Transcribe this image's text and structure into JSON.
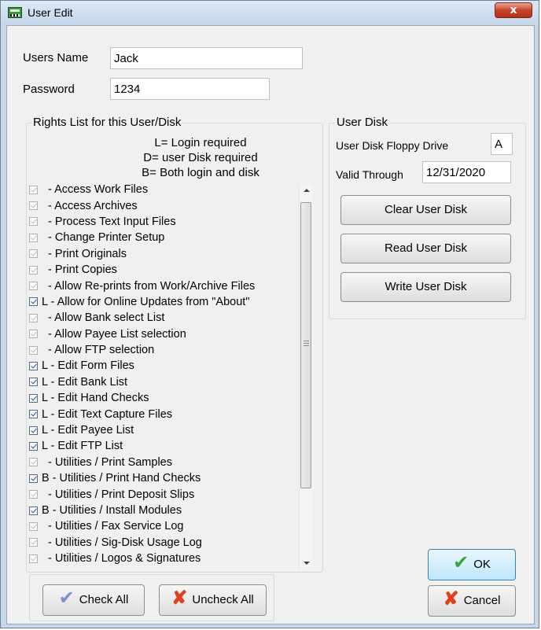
{
  "window": {
    "title": "User Edit",
    "close_label": "x"
  },
  "users_name": {
    "label": "Users Name",
    "value": "Jack"
  },
  "password": {
    "label": "Password",
    "value": "1234"
  },
  "rights": {
    "group_title": "Rights List for this User/Disk",
    "legend": [
      "L= Login required",
      "D= user Disk required",
      "B= Both login and disk"
    ],
    "items": [
      {
        "text": "  - Access Work Files",
        "checked": false
      },
      {
        "text": "  - Access Archives",
        "checked": false
      },
      {
        "text": "  - Process Text Input Files",
        "checked": false
      },
      {
        "text": "  - Change Printer Setup",
        "checked": false
      },
      {
        "text": "  - Print Originals",
        "checked": false
      },
      {
        "text": "  - Print Copies",
        "checked": false
      },
      {
        "text": "  - Allow Re-prints from Work/Archive Files",
        "checked": false
      },
      {
        "text": "L - Allow for Online Updates from \"About\"",
        "checked": true
      },
      {
        "text": "  - Allow Bank select List",
        "checked": false
      },
      {
        "text": "  - Allow Payee List selection",
        "checked": false
      },
      {
        "text": "  - Allow FTP selection",
        "checked": false
      },
      {
        "text": "L - Edit Form Files",
        "checked": true
      },
      {
        "text": "L - Edit Bank List",
        "checked": true
      },
      {
        "text": "L - Edit Hand Checks",
        "checked": true
      },
      {
        "text": "L - Edit Text Capture Files",
        "checked": true
      },
      {
        "text": "L - Edit Payee List",
        "checked": true
      },
      {
        "text": "L - Edit FTP List",
        "checked": true
      },
      {
        "text": "  - Utilities / Print Samples",
        "checked": false
      },
      {
        "text": "B - Utilities / Print Hand Checks",
        "checked": true
      },
      {
        "text": "  - Utilities / Print Deposit Slips",
        "checked": false
      },
      {
        "text": "B - Utilities / Install Modules",
        "checked": true
      },
      {
        "text": "  - Utilities / Fax Service Log",
        "checked": false
      },
      {
        "text": "  - Utilities / Sig-Disk Usage Log",
        "checked": false
      },
      {
        "text": "  - Utilities / Logos & Signatures",
        "checked": false
      }
    ]
  },
  "user_disk": {
    "group_title": "User Disk",
    "floppy_label": "User Disk Floppy Drive",
    "floppy_value": "A",
    "valid_label": "Valid Through",
    "valid_value": "12/31/2020",
    "clear_label": "Clear User Disk",
    "read_label": "Read User Disk",
    "write_label": "Write User Disk"
  },
  "buttons": {
    "check_all": "Check All",
    "uncheck_all": "Uncheck All",
    "ok": "OK",
    "cancel": "Cancel"
  },
  "icons": {
    "app": "app-icon",
    "close": "close-icon",
    "check_all": "blue-check-icon",
    "uncheck_all": "red-x-icon",
    "ok": "green-check-icon",
    "cancel": "red-x-icon"
  }
}
